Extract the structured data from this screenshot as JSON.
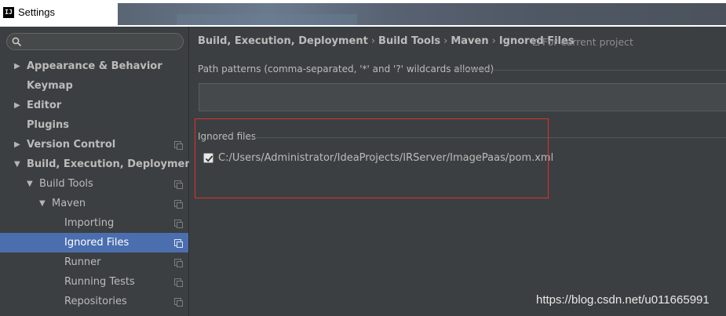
{
  "window": {
    "title": "Settings",
    "app_icon_text": "IJ"
  },
  "search": {
    "placeholder": ""
  },
  "sidebar": {
    "items": [
      {
        "label": "Appearance & Behavior",
        "arrow": "▶",
        "bold": true
      },
      {
        "label": "Keymap",
        "arrow": "",
        "bold": true
      },
      {
        "label": "Editor",
        "arrow": "▶",
        "bold": true
      },
      {
        "label": "Plugins",
        "arrow": "",
        "bold": true
      },
      {
        "label": "Version Control",
        "arrow": "▶",
        "bold": true
      },
      {
        "label": "Build, Execution, Deployment",
        "arrow": "▼",
        "bold": true
      },
      {
        "label": "Build Tools",
        "arrow": "▼",
        "bold": false
      },
      {
        "label": "Maven",
        "arrow": "▼",
        "bold": false
      },
      {
        "label": "Importing",
        "arrow": "",
        "bold": false
      },
      {
        "label": "Ignored Files",
        "arrow": "",
        "bold": false,
        "selected": true
      },
      {
        "label": "Runner",
        "arrow": "",
        "bold": false
      },
      {
        "label": "Running Tests",
        "arrow": "",
        "bold": false
      },
      {
        "label": "Repositories",
        "arrow": "",
        "bold": false
      }
    ]
  },
  "breadcrumb": {
    "items": [
      "Build, Execution, Deployment",
      "Build Tools",
      "Maven",
      "Ignored Files"
    ],
    "separator": "›",
    "scope": "For current project"
  },
  "path_patterns": {
    "label": "Path patterns (comma-separated, '*' and '?' wildcards allowed)",
    "value": ""
  },
  "ignored_files": {
    "label": "Ignored files",
    "files": [
      {
        "path": "C:/Users/Administrator/IdeaProjects/IRServer/ImagePaas/pom.xml",
        "checked": true
      }
    ]
  },
  "watermark": "https://blog.csdn.net/u011665991",
  "colors": {
    "panel_bg": "#3c3f41",
    "selection": "#4b6eaf",
    "highlight_border": "#e03030",
    "text": "#bbbbbb"
  }
}
